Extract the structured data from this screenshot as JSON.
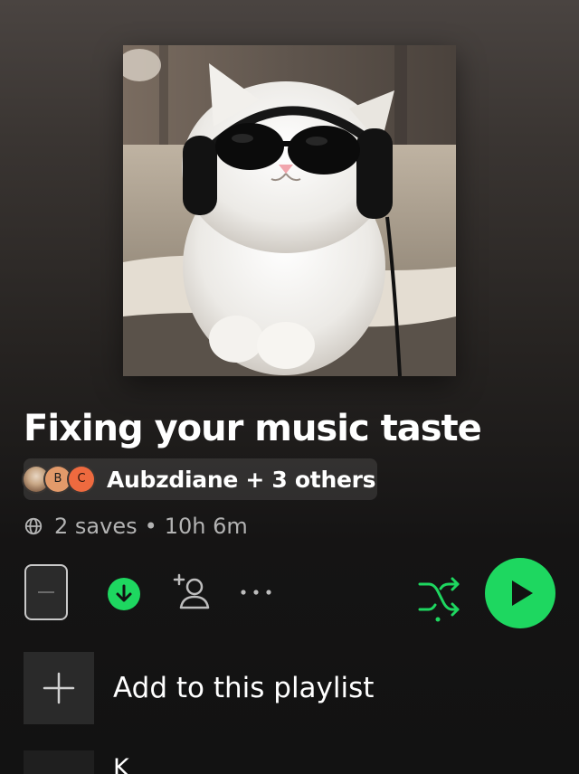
{
  "playlist": {
    "title": "Fixing your music taste",
    "cover_alt": "White cat wearing round black sunglasses and headphones"
  },
  "owners": {
    "label": "Aubzdiane + 3 others",
    "avatars": [
      {
        "initial": "",
        "color": "#c9a887"
      },
      {
        "initial": "B",
        "color": "#e39a6a"
      },
      {
        "initial": "C",
        "color": "#ee6a3f"
      }
    ]
  },
  "meta": {
    "saves": "2 saves",
    "separator": "•",
    "duration": "10h 6m"
  },
  "actions": {
    "download_icon": "download-icon",
    "add_collaborator_icon": "add-user-icon",
    "more_icon": "more-icon",
    "shuffle_icon": "shuffle-icon",
    "play_icon": "play-icon"
  },
  "list": {
    "add_label": "Add to this playlist",
    "tracks": [
      {
        "title": "K"
      }
    ]
  },
  "colors": {
    "accent": "#1ed760",
    "muted_text": "#b3b3b3",
    "background": "#121212"
  }
}
